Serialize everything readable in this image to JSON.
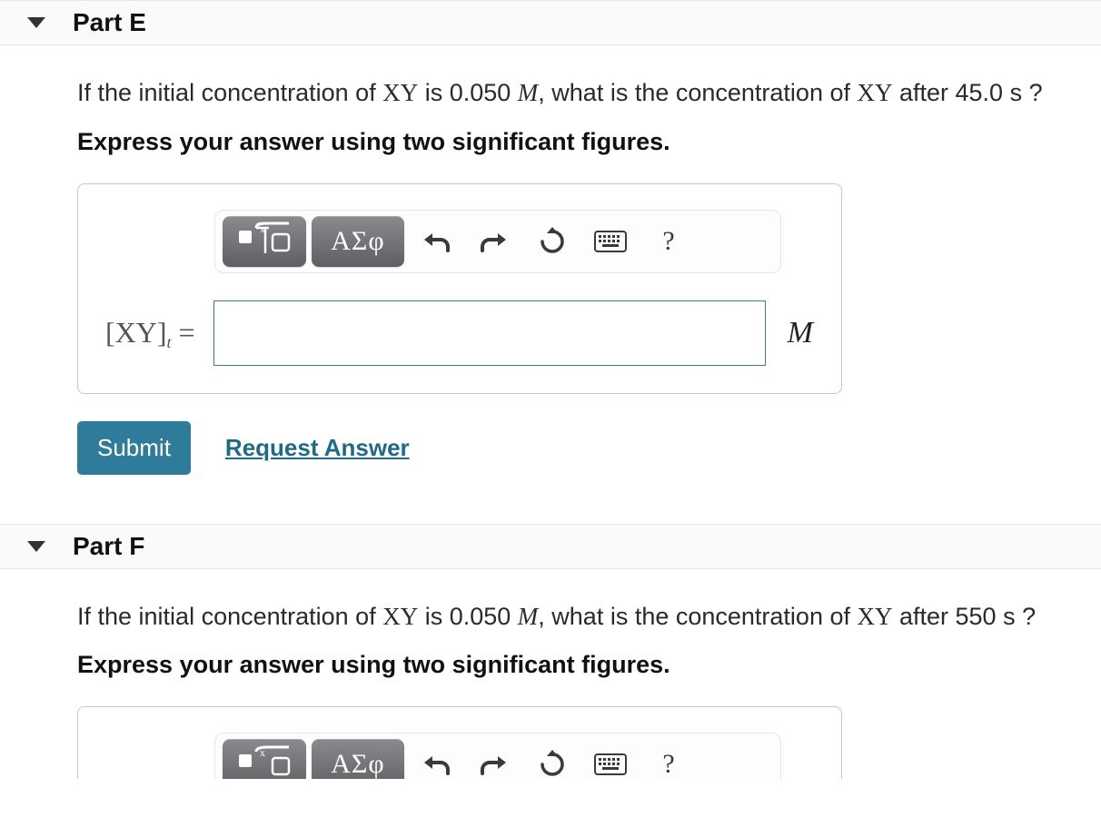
{
  "parts": [
    {
      "title": "Part E",
      "prompt_before": "If the initial concentration of ",
      "var1": "XY",
      "prompt_mid1": " is 0.050 ",
      "unit_inline": "M",
      "prompt_mid2": ", what is the concentration of ",
      "var2": "XY",
      "prompt_after": " after 45.0 s ?",
      "instruction": "Express your answer using two significant figures.",
      "lhs_bracket_open": "[",
      "lhs_var": "XY",
      "lhs_bracket_close": "]",
      "lhs_sub": "t",
      "lhs_eq": " = ",
      "input_value": "",
      "unit": "M",
      "toolbar": {
        "greek": "ΑΣφ",
        "help": "?"
      },
      "submit": "Submit",
      "request": "Request Answer"
    },
    {
      "title": "Part F",
      "prompt_before": "If the initial concentration of ",
      "var1": "XY",
      "prompt_mid1": " is 0.050 ",
      "unit_inline": "M",
      "prompt_mid2": ", what is the concentration of ",
      "var2": "XY",
      "prompt_after": " after 550 s ?",
      "instruction": "Express your answer using two significant figures.",
      "toolbar": {
        "greek": "ΑΣφ",
        "help": "?"
      }
    }
  ]
}
